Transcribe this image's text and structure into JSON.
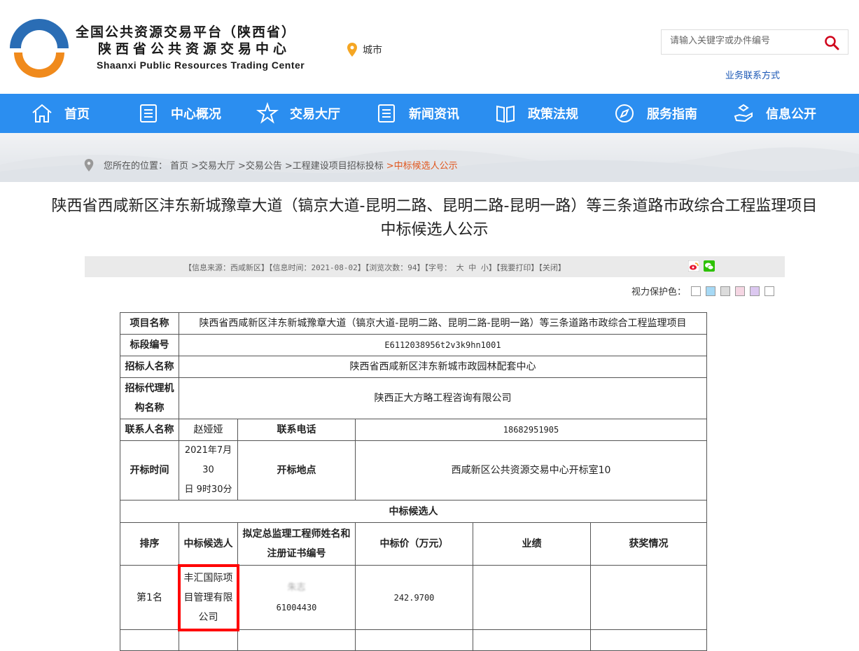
{
  "header": {
    "logo_line1": "全国公共资源交易平台（陕西省）",
    "logo_line2": "陕西省公共资源交易中心",
    "logo_line3": "Shaanxi Public Resources Trading Center",
    "city_label": "城市",
    "search_placeholder": "请输入关键字或办件编号",
    "business_contact": "业务联系方式"
  },
  "nav": {
    "items": [
      {
        "label": "首页",
        "icon": "home-icon"
      },
      {
        "label": "中心概况",
        "icon": "document-icon"
      },
      {
        "label": "交易大厅",
        "icon": "star-icon"
      },
      {
        "label": "新闻资讯",
        "icon": "list-icon"
      },
      {
        "label": "政策法规",
        "icon": "book-icon"
      },
      {
        "label": "服务指南",
        "icon": "compass-icon"
      },
      {
        "label": "信息公开",
        "icon": "hand-icon"
      }
    ]
  },
  "breadcrumb": {
    "prefix": "您所在的位置：",
    "items": [
      "首页",
      ">交易大厅",
      ">交易公告",
      ">工程建设项目招标投标"
    ],
    "current": ">中标候选人公示"
  },
  "article": {
    "title_line1": "陕西省西咸新区沣东新城豫章大道（镐京大道-昆明二路、昆明二路-昆明一路）等三条道路市政综合工程监理项目",
    "title_line2": "中标候选人公示",
    "info_bar": "【信息来源：西咸新区】【信息时间：2021-08-02】【浏览次数：94】【字号： 大 中 小】【我要打印】【关闭】",
    "eye_care_label": "视力保护色：",
    "eye_care_colors": [
      "#ffffff",
      "#a6d9f5",
      "#dcdcdc",
      "#f5d6e3",
      "#dcc8f0",
      "#ffffff"
    ]
  },
  "table": {
    "project_name_label": "项目名称",
    "project_name": "陕西省西咸新区沣东新城豫章大道（镐京大道-昆明二路、昆明二路-昆明一路）等三条道路市政综合工程监理项目",
    "section_no_label": "标段编号",
    "section_no": "E6112038956t2v3k9hn1001",
    "tenderer_label": "招标人名称",
    "tenderer": "陕西省西咸新区沣东新城市政园林配套中心",
    "agency_label_1": "招标代理机",
    "agency_label_2": "构名称",
    "agency": "陕西正大方略工程咨询有限公司",
    "contact_label": "联系人名称",
    "contact": "赵娅娅",
    "phone_label": "联系电话",
    "phone": "18682951905",
    "open_time_label": "开标时间",
    "open_time_1": "2021年7月30",
    "open_time_2": "日 9时30分",
    "open_place_label": "开标地点",
    "open_place": "西咸新区公共资源交易中心开标室10",
    "candidates_header": "中标候选人",
    "col_rank": "排序",
    "col_candidate": "中标候选人",
    "col_engineer_1": "拟定总监理工程师姓名和",
    "col_engineer_2": "注册证书编号",
    "col_price": "中标价（万元）",
    "col_performance": "业绩",
    "col_awards": "获奖情况",
    "rows": [
      {
        "rank": "第1名",
        "candidate_1": "丰汇国际项",
        "candidate_2": "目管理有限",
        "candidate_3": "公司",
        "engineer_name": "朱志",
        "engineer_cert": "61004430",
        "price": "242.9700",
        "performance": "",
        "awards": ""
      }
    ]
  }
}
